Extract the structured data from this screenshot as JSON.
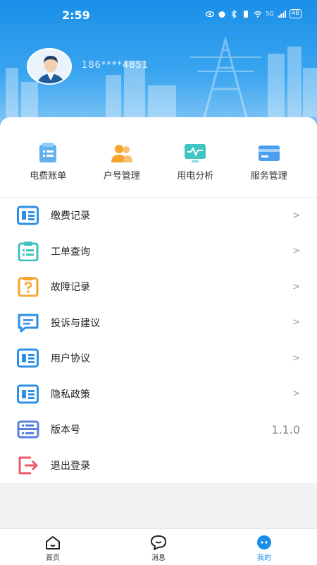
{
  "status": {
    "time": "2:59",
    "signal": "5G",
    "battery": "46"
  },
  "profile": {
    "phone": "186****4851"
  },
  "quick_actions": [
    {
      "label": "电费账单",
      "icon": "bill-icon",
      "color": "#5fb1f0"
    },
    {
      "label": "户号管理",
      "icon": "users-icon",
      "color": "#f5a52b"
    },
    {
      "label": "用电分析",
      "icon": "monitor-chart-icon",
      "color": "#3fc6c4"
    },
    {
      "label": "服务管理",
      "icon": "card-icon",
      "color": "#4a9ff0"
    }
  ],
  "menu": [
    {
      "label": "缴费记录",
      "icon": "document-list-icon",
      "color": "#2e8fe6",
      "trailing": "chevron"
    },
    {
      "label": "工单查询",
      "icon": "clipboard-icon",
      "color": "#3fc1bd",
      "trailing": "chevron"
    },
    {
      "label": "故障记录",
      "icon": "question-doc-icon",
      "color": "#f5a52b",
      "trailing": "chevron"
    },
    {
      "label": "投诉与建议",
      "icon": "message-icon",
      "color": "#2e8fe6",
      "trailing": "chevron"
    },
    {
      "label": "用户协议",
      "icon": "document-list-icon",
      "color": "#2e8fe6",
      "trailing": "chevron"
    },
    {
      "label": "隐私政策",
      "icon": "document-list-icon",
      "color": "#2e8fe6",
      "trailing": "chevron"
    },
    {
      "label": "版本号",
      "icon": "server-icon",
      "color": "#5b7fe0",
      "trailing": "value",
      "value": "1.1.0"
    },
    {
      "label": "退出登录",
      "icon": "logout-icon",
      "color": "#ee5a6b",
      "trailing": "none"
    }
  ],
  "chevron": ">",
  "tabs": [
    {
      "label": "首页",
      "icon": "home-icon",
      "active": false
    },
    {
      "label": "消息",
      "icon": "chat-icon",
      "active": false
    },
    {
      "label": "我的",
      "icon": "profile-icon",
      "active": true
    }
  ],
  "colors": {
    "primary": "#1a8fe8"
  }
}
